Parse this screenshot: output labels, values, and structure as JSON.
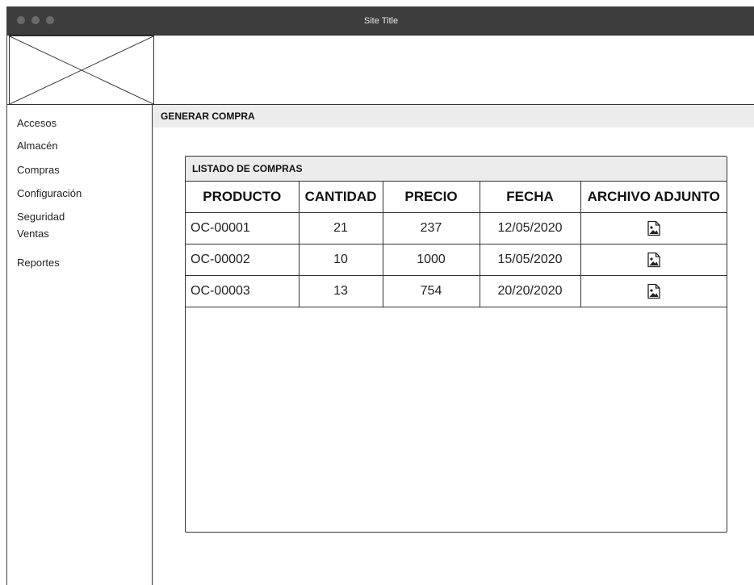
{
  "window": {
    "title": "Site Title"
  },
  "sidebar": {
    "items": [
      {
        "label": "Accesos"
      },
      {
        "label": "Almacén"
      },
      {
        "label": "Compras"
      },
      {
        "label": "Configuración"
      },
      {
        "label": "Seguridad"
      },
      {
        "label": "Ventas"
      },
      {
        "label": "Reportes"
      }
    ]
  },
  "header": {
    "title": "GENERAR COMPRA"
  },
  "panel": {
    "title": "LISTADO DE COMPRAS",
    "columns": [
      "PRODUCTO",
      "CANTIDAD",
      "PRECIO",
      "FECHA",
      "ARCHIVO ADJUNTO"
    ],
    "rows": [
      {
        "producto": "OC-00001",
        "cantidad": "21",
        "precio": "237",
        "fecha": "12/05/2020",
        "adjunto_icon": "image-file-icon"
      },
      {
        "producto": "OC-00002",
        "cantidad": "10",
        "precio": "1000",
        "fecha": "15/05/2020",
        "adjunto_icon": "image-file-icon"
      },
      {
        "producto": "OC-00003",
        "cantidad": "13",
        "precio": "754",
        "fecha": "20/20/2020",
        "adjunto_icon": "image-file-icon"
      }
    ]
  },
  "colors": {
    "titlebar": "#3d3d3d",
    "header_bg": "#ececec",
    "border": "#333333"
  }
}
